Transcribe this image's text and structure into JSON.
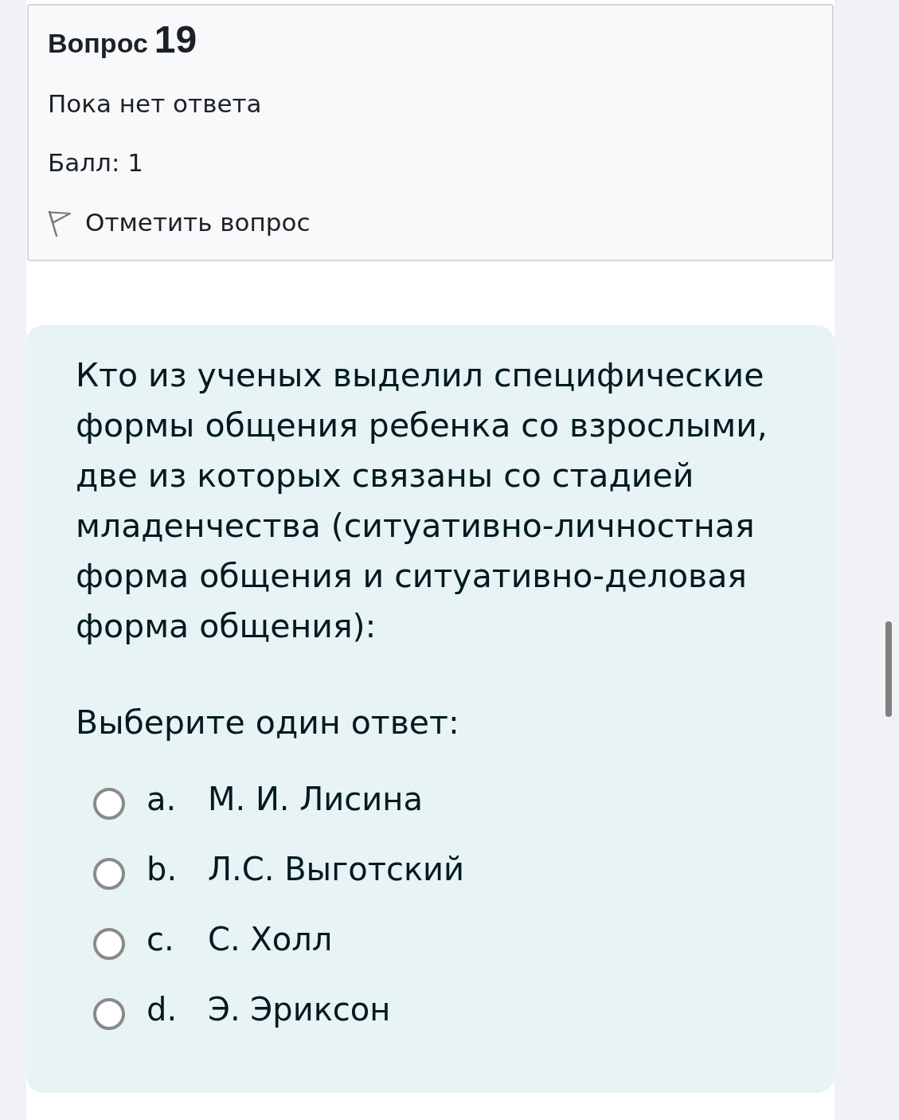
{
  "question_info": {
    "label": "Вопрос",
    "number": "19",
    "status": "Пока нет ответа",
    "grade": "Балл: 1",
    "flag": {
      "label": "Отметить вопрос",
      "flagged": false
    }
  },
  "question": {
    "text": "Кто из ученых выделил специфические формы общения ребенка со взрослыми, две из которых связаны со стадией младенчества (ситуативно-личностная форма общения и ситуативно-деловая форма общения):",
    "prompt": "Выберите один ответ:",
    "options": [
      {
        "letter": "a.",
        "label": "М. И. Лисина",
        "selected": false
      },
      {
        "letter": "b.",
        "label": "Л.С. Выготский",
        "selected": false
      },
      {
        "letter": "c.",
        "label": "С. Холл",
        "selected": false
      },
      {
        "letter": "d.",
        "label": "Э. Эриксон",
        "selected": false
      }
    ]
  }
}
